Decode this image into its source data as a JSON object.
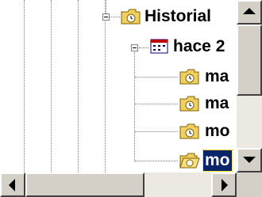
{
  "tree": {
    "nodes": [
      {
        "label": "Historial",
        "icon": "folder-icon",
        "selected": false
      },
      {
        "label": "hace 2",
        "icon": "calendar-icon",
        "selected": false
      },
      {
        "label": "ma",
        "icon": "folder-icon",
        "selected": false
      },
      {
        "label": "ma",
        "icon": "folder-icon",
        "selected": false
      },
      {
        "label": "mo",
        "icon": "folder-icon",
        "selected": false
      },
      {
        "label": "mo",
        "icon": "folder-icon",
        "selected": true
      }
    ]
  },
  "colors": {
    "selection": "#0a246a",
    "scrollbar_track": "#ece9e3",
    "scrollbar_button": "#d4d0c8",
    "folder": "#f0d060"
  }
}
